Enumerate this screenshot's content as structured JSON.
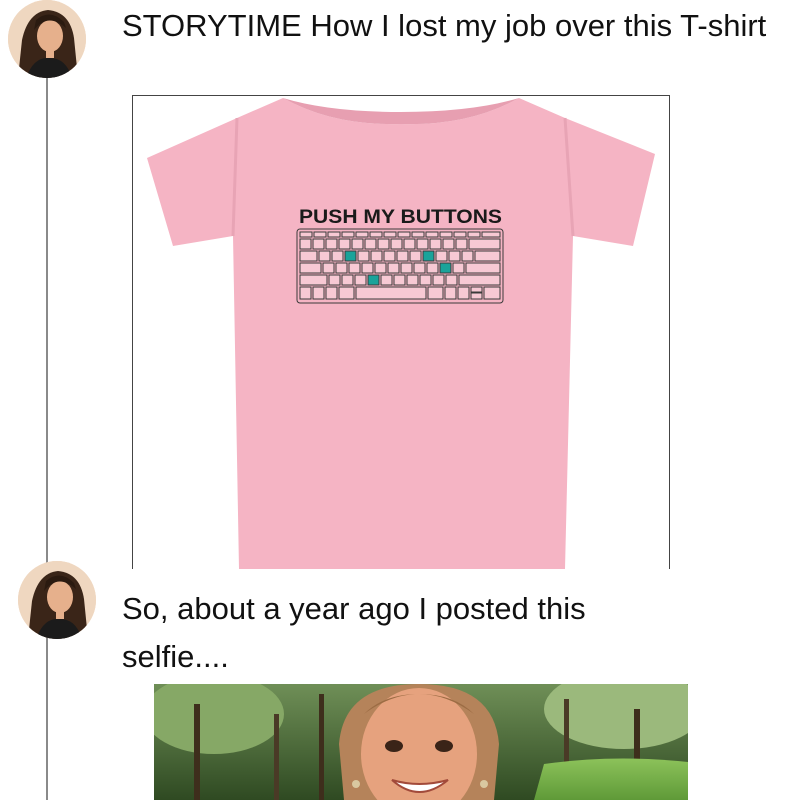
{
  "thread": {
    "posts": [
      {
        "avatar_icon": "woman-avatar-icon",
        "text": "STORYTIME How I lost my job over this T-shirt",
        "image": {
          "description_icon": "pink-keyboard-tshirt-image",
          "shirt_text": "PUSH MY BUTTONS",
          "shirt_color": "#f5b4c4",
          "highlight_color": "#1aa39a"
        }
      },
      {
        "avatar_icon": "woman-avatar-icon",
        "text": "So, about a year ago I posted this selfie....",
        "image": {
          "description_icon": "smiling-girl-selfie-image"
        }
      }
    ],
    "thread_line_color": "#8a8a8a"
  }
}
